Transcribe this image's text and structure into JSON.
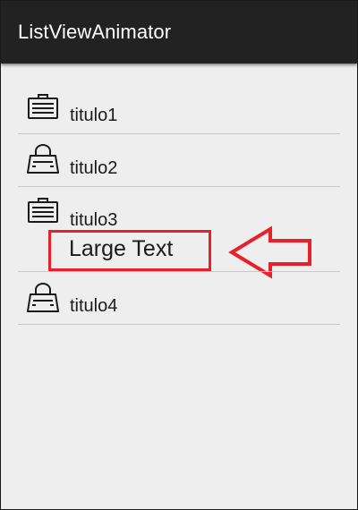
{
  "app": {
    "title": "ListViewAnimator"
  },
  "list": {
    "items": [
      {
        "title": "titulo1",
        "icon": "briefcase-icon"
      },
      {
        "title": "titulo2",
        "icon": "shopping-bag-icon"
      },
      {
        "title": "titulo3",
        "icon": "briefcase-icon"
      },
      {
        "title": "titulo4",
        "icon": "shopping-bag-icon"
      }
    ],
    "expanded_item": {
      "index": 2,
      "text": "Large Text"
    }
  },
  "annotation": {
    "color": "#e8202a",
    "shape": "arrow-pointing-left"
  },
  "colors": {
    "action_bar": "#222222",
    "background": "#eeeeee",
    "divider": "#c8c8c8"
  }
}
